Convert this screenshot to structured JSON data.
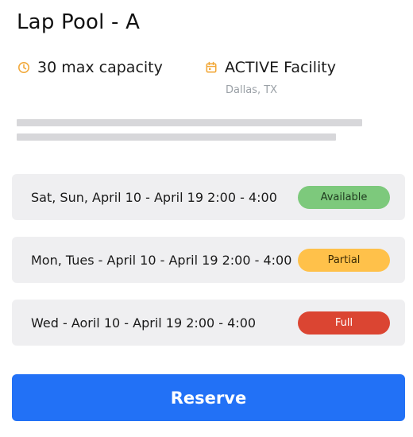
{
  "pool": {
    "title": "Lap Pool - A",
    "capacity": "30 max capacity",
    "facility": "ACTIVE Facility",
    "location": "Dallas, TX"
  },
  "icons": {
    "capacity": "clock-icon",
    "facility": "calendar-icon",
    "accent_color": "#f2a93b"
  },
  "slots": [
    {
      "label": "Sat, Sun, April 10 - April 19 2:00 - 4:00",
      "status": "Available",
      "status_color": "#7dc97c"
    },
    {
      "label": "Mon, Tues - April 10 - April 19 2:00 - 4:00",
      "status": "Partial",
      "status_color": "#ffc14a"
    },
    {
      "label": "Wed - Aoril 10 - April 19 2:00 - 4:00",
      "status": "Full",
      "status_color": "#db4532"
    }
  ],
  "actions": {
    "reserve_label": "Reserve",
    "reserve_color": "#2271f6"
  }
}
